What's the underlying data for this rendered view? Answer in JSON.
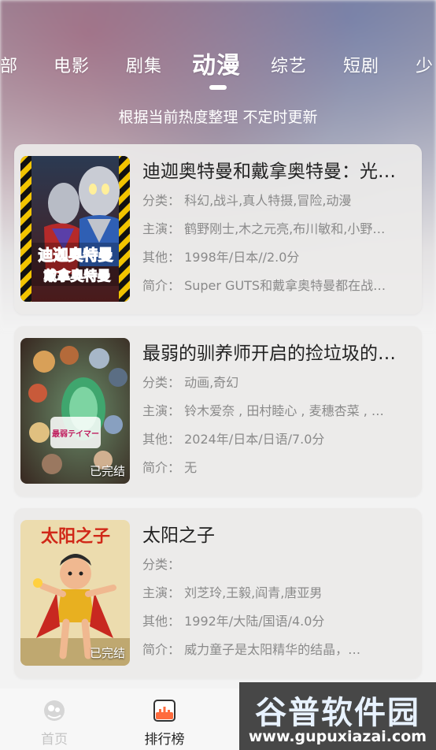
{
  "tabs": [
    "部",
    "电影",
    "剧集",
    "动漫",
    "综艺",
    "短剧",
    "少"
  ],
  "subtitle": "根据当前热度整理 不定时更新",
  "cards": [
    {
      "title": "迪迦奥特曼和戴拿奥特曼：光…",
      "category": "分类：  科幻,战斗,真人特摄,冒险,动漫",
      "cast": "主演：  鹤野刚士,木之元亮,布川敏和,小野…",
      "other": "其他：  1998年/日本//2.0分",
      "intro": "简介：  Super GUTS和戴拿奥特曼都在战…",
      "poster_label": ""
    },
    {
      "title": "最弱的驯养师开启的捡垃圾的…",
      "category": "分类：  动画,奇幻",
      "cast": "主演：  铃木爱奈 , 田村睦心 , 麦穗杏菜 , …",
      "other": "其他：  2024年/日本/日语/7.0分",
      "intro": "简介：  无",
      "poster_label": "已完结"
    },
    {
      "title": "太阳之子",
      "category": "分类：",
      "cast": "主演：  刘芝玲,王毅,阎青,唐亚男",
      "other": "其他：  1992年/大陆/国语/4.0分",
      "intro": "简介：          威力童子是太阳精华的结晶，…",
      "poster_label": "已完结"
    }
  ],
  "poster_texts": {
    "p1": "迪迦奥特曼",
    "p1b": "戴拿奥特曼",
    "p2": "最弱テイマー",
    "p3": "太阳之子"
  },
  "nav": [
    {
      "label": "首页",
      "icon": "home-icon"
    },
    {
      "label": "排行榜",
      "icon": "ranking-icon"
    }
  ],
  "watermark": {
    "main": "谷普软件园",
    "url": "www.gupuxiazai.com"
  },
  "colors": {
    "accent": "#ff6b3d",
    "text": "#222222",
    "muted": "#8a8a8a"
  }
}
